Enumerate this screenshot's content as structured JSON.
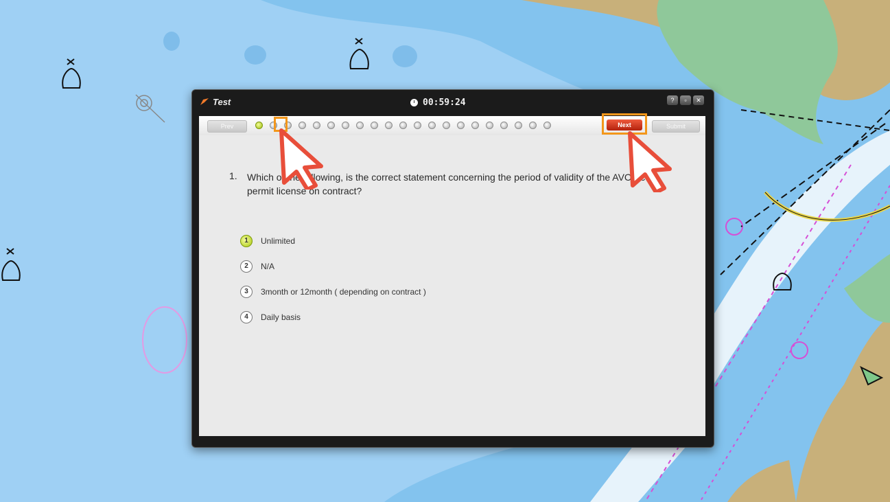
{
  "dialog": {
    "title": "Test",
    "timer": "00:59:24",
    "window_buttons": [
      "?",
      "▫",
      "✕"
    ]
  },
  "nav": {
    "prev_label": "Prev",
    "next_label": "Next",
    "submit_label": "Submit",
    "question_count": 21,
    "answered_index": 0,
    "current_index": 1
  },
  "question": {
    "number": "1.",
    "text": "Which of the following, is the correct statement concerning the period of validity of the AVCS cell-permit license on contract?",
    "options": [
      {
        "badge": "1",
        "label": "Unlimited",
        "selected": true
      },
      {
        "badge": "2",
        "label": "N/A",
        "selected": false
      },
      {
        "badge": "3",
        "label": "3month or 12month ( depending on contract )",
        "selected": false
      },
      {
        "badge": "4",
        "label": "Daily basis",
        "selected": false
      }
    ]
  },
  "colors": {
    "highlight": "#f3971b",
    "cursor_fill": "#e84e3a",
    "next_button": "#d6361a",
    "sea_shallow": "#9fd0f4",
    "sea_mid": "#7fc0ec",
    "land": "#c8b07a",
    "land_green": "#8fc89a"
  },
  "icons": [
    "clock-icon",
    "pointer-cursor-icon",
    "buoy-icon"
  ]
}
